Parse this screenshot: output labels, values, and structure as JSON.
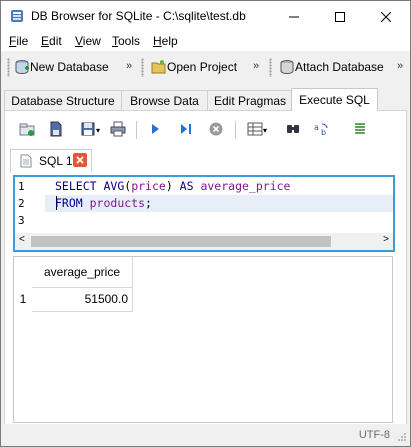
{
  "window": {
    "title": "DB Browser for SQLite - C:\\sqlite\\test.db",
    "controls": [
      "minimize",
      "maximize",
      "close"
    ]
  },
  "menu": {
    "items": [
      {
        "label": "File"
      },
      {
        "label": "Edit"
      },
      {
        "label": "View"
      },
      {
        "label": "Tools"
      },
      {
        "label": "Help"
      }
    ]
  },
  "toolbar": {
    "new_database": "New Database",
    "open_project": "Open Project",
    "attach_database": "Attach Database",
    "overflow": "»"
  },
  "tabs": [
    {
      "label": "Database Structure",
      "active": false
    },
    {
      "label": "Browse Data",
      "active": false
    },
    {
      "label": "Edit Pragmas",
      "active": false
    },
    {
      "label": "Execute SQL",
      "active": true
    }
  ],
  "sql_tab": {
    "label": "SQL 1"
  },
  "editor": {
    "line_numbers": [
      "1",
      "2",
      "3"
    ],
    "lines": [
      [
        {
          "t": "SELECT ",
          "c": "kw"
        },
        {
          "t": "AVG",
          "c": "fn"
        },
        {
          "t": "(",
          "c": "plain"
        },
        {
          "t": "price",
          "c": "id"
        },
        {
          "t": ") ",
          "c": "plain"
        },
        {
          "t": "AS ",
          "c": "kw"
        },
        {
          "t": "average_price",
          "c": "id"
        }
      ],
      [
        {
          "t": "FROM ",
          "c": "kw"
        },
        {
          "t": "products",
          "c": "id"
        },
        {
          "t": ";",
          "c": "plain"
        }
      ],
      []
    ]
  },
  "results": {
    "columns": [
      "average_price"
    ],
    "rows": [
      {
        "row_number": "1",
        "cells": [
          "51500.0"
        ]
      }
    ]
  },
  "status": {
    "encoding": "UTF-8"
  },
  "colors": {
    "accent": "#3d9bd9",
    "keyword": "#00008b",
    "identifier": "#7a1a8c"
  }
}
